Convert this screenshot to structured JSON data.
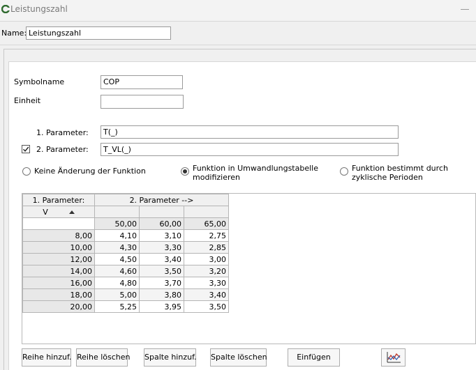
{
  "window": {
    "title": "Leistungszahl"
  },
  "name_row": {
    "label": "Name:",
    "value": "Leistungszahl"
  },
  "form": {
    "symbolname_label": "Symbolname",
    "symbolname_value": "COP",
    "einheit_label": "Einheit",
    "einheit_value": "",
    "param1_label": "1. Parameter:",
    "param1_value": "T(_)",
    "param2_label": "2. Parameter:",
    "param2_value": "T_VL(_)",
    "param2_checked": true
  },
  "options": [
    {
      "label": "Keine Änderung der Funktion",
      "selected": false
    },
    {
      "label": "Funktion in Umwandlungstabelle modifizieren",
      "selected": true
    },
    {
      "label": "Funktion bestimmt durch zyklische Perioden",
      "selected": false
    }
  ],
  "table": {
    "header_param1": "1. Parameter:",
    "header_param2": "2. Parameter -->",
    "sort_col_label": "V",
    "column_values": [
      "50,00",
      "60,00",
      "65,00"
    ],
    "rows": [
      {
        "key": "8,00",
        "values": [
          "4,10",
          "3,10",
          "2,75"
        ]
      },
      {
        "key": "10,00",
        "values": [
          "4,30",
          "3,30",
          "2,85"
        ]
      },
      {
        "key": "12,00",
        "values": [
          "4,50",
          "3,40",
          "3,00"
        ]
      },
      {
        "key": "14,00",
        "values": [
          "4,60",
          "3,50",
          "3,20"
        ]
      },
      {
        "key": "16,00",
        "values": [
          "4,80",
          "3,70",
          "3,30"
        ]
      },
      {
        "key": "18,00",
        "values": [
          "5,00",
          "3,80",
          "3,40"
        ]
      },
      {
        "key": "20,00",
        "values": [
          "5,25",
          "3,95",
          "3,50"
        ]
      }
    ]
  },
  "buttons": {
    "add_row": "Reihe hinzuf.",
    "delete_row": "Reihe löschen",
    "add_column": "Spalte hinzuf.",
    "delete_column": "Spalte löschen",
    "insert": "Einfügen",
    "chart_icon": "line-chart-icon"
  }
}
